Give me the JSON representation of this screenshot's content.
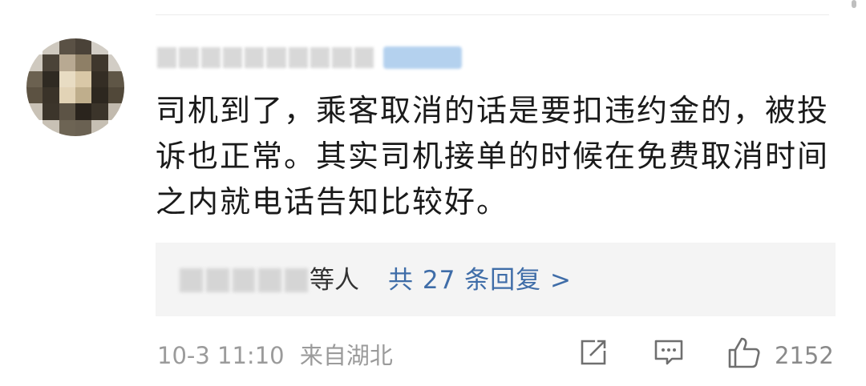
{
  "comment": {
    "text": "司机到了，乘客取消的话是要扣违约金的，被投诉也正常。其实司机接单的时候在免费取消时间之内就电话告知比较好。",
    "avatar_icon": "pixelated-avatar-icon"
  },
  "replies": {
    "suffix": "等人",
    "link_label": "共 27 条回复 >"
  },
  "meta": {
    "date": "10-3 11:10",
    "location": "来自湖北"
  },
  "actions": {
    "like_count": "2152",
    "share_icon": "share-icon",
    "comment_icon": "comment-icon",
    "like_icon": "thumbs-up-icon"
  },
  "colors": {
    "link": "#3f6da8",
    "meta_text": "#9b9b9b",
    "reply_background": "#f4f4f4",
    "body_text": "#1a1a1a"
  }
}
